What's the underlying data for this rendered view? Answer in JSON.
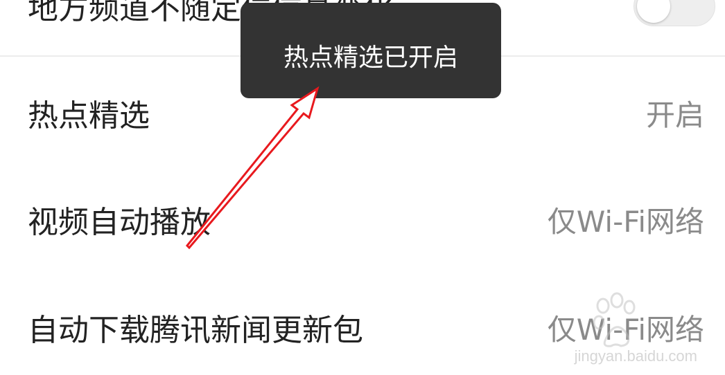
{
  "settings": {
    "top_row": {
      "label": "地方频道不随定位信息变化"
    },
    "rows": [
      {
        "label": "热点精选",
        "value": "开启"
      },
      {
        "label": "视频自动播放",
        "value": "仅Wi-Fi网络"
      },
      {
        "label": "自动下载腾讯新闻更新包",
        "value": "仅Wi-Fi网络"
      }
    ]
  },
  "toast": {
    "message": "热点精选已开启"
  },
  "annotation": {
    "arrow_color": "#e8191e"
  },
  "watermark": {
    "text": "jingyan.baidu.com"
  }
}
